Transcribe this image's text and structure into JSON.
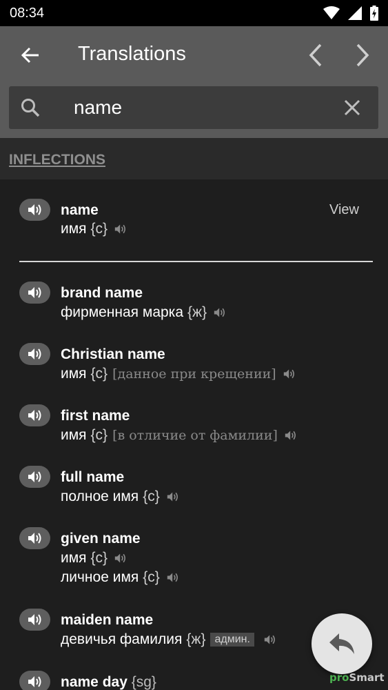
{
  "status_bar": {
    "time": "08:34",
    "icons": [
      "wifi-icon",
      "signal-icon",
      "battery-charging-icon"
    ]
  },
  "app_bar": {
    "title": "Translations",
    "back_icon": "arrow-left-icon",
    "prev_icon": "chevron-left-icon",
    "next_icon": "chevron-right-icon"
  },
  "search": {
    "value": "name",
    "icon": "search-icon",
    "clear_icon": "close-icon"
  },
  "section": {
    "title": "INFLECTIONS"
  },
  "main_entry": {
    "term": "name",
    "view_label": "View",
    "translations": [
      {
        "text": "имя",
        "gender": "{c}"
      }
    ]
  },
  "entries": [
    {
      "term": "brand name",
      "translations": [
        {
          "text": "фирменная марка",
          "gender": "{ж}"
        }
      ]
    },
    {
      "term": "Christian name",
      "translations": [
        {
          "text": "имя",
          "gender": "{c}",
          "note": "[данное при крещении]"
        }
      ]
    },
    {
      "term": "first name",
      "translations": [
        {
          "text": "имя",
          "gender": "{c}",
          "note": "[в отличие от фамилии]"
        }
      ]
    },
    {
      "term": "full name",
      "translations": [
        {
          "text": "полное имя",
          "gender": "{c}"
        }
      ]
    },
    {
      "term": "given name",
      "translations": [
        {
          "text": "имя",
          "gender": "{c}"
        },
        {
          "text": "личное имя",
          "gender": "{c}"
        }
      ]
    },
    {
      "term": "maiden name",
      "translations": [
        {
          "text": "девичья фамилия",
          "gender": "{ж}",
          "label": "админ."
        }
      ]
    },
    {
      "term": "name day",
      "term_tag": "{sg}",
      "translations": []
    }
  ],
  "fab": {
    "icon": "reply-icon"
  },
  "watermark": {
    "part1": "pro",
    "part2": "Smart"
  },
  "colors": {
    "app_bar": "#5a5a5a",
    "background": "#1e1e1e",
    "speak_button": "#5e5e5e",
    "fab": "#e4e4e4"
  }
}
